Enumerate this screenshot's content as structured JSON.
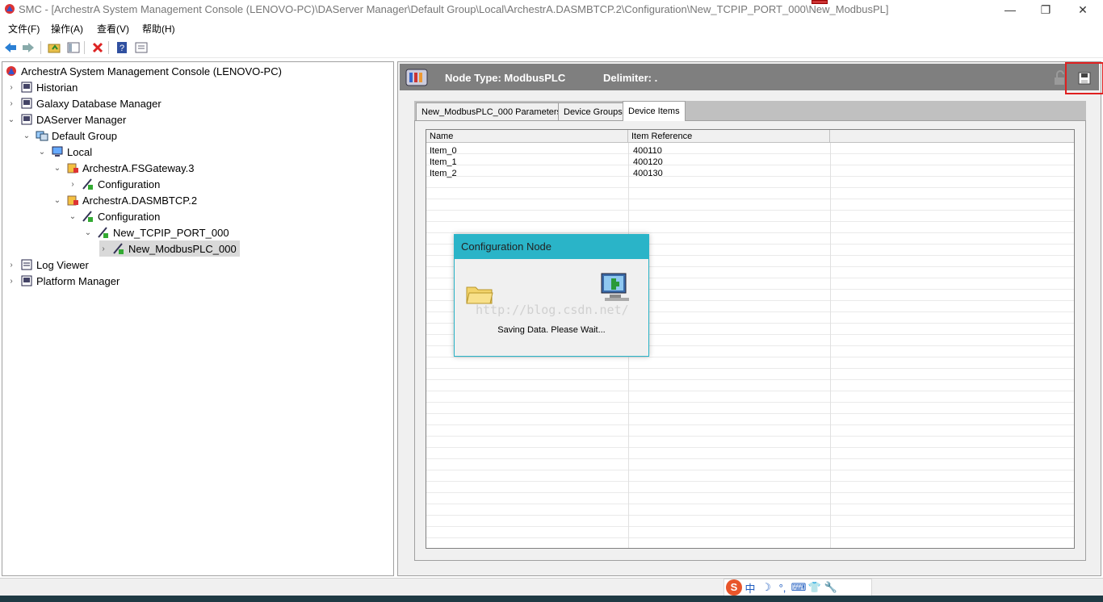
{
  "window": {
    "title": "SMC - [ArchestrA System Management Console (LENOVO-PC)\\DAServer Manager\\Default Group\\Local\\ArchestrA.DASMBTCP.2\\Configuration\\New_TCPIP_PORT_000\\New_ModbusPL]",
    "min_glyph": "—",
    "max_glyph": "❐",
    "close_glyph": "✕"
  },
  "menu": [
    "文件(F)",
    "操作(A)",
    "查看(V)",
    "帮助(H)"
  ],
  "tree": {
    "root": "ArchestrA System Management Console (LENOVO-PC)",
    "items": [
      {
        "label": "Historian",
        "exp": "›"
      },
      {
        "label": "Galaxy Database Manager",
        "exp": "›"
      },
      {
        "label": "DAServer Manager",
        "exp": "⌄"
      },
      {
        "label": "Default Group",
        "exp": "⌄"
      },
      {
        "label": "Local",
        "exp": "⌄"
      },
      {
        "label": "ArchestrA.FSGateway.3",
        "exp": "⌄"
      },
      {
        "label": "Configuration",
        "exp": "›"
      },
      {
        "label": "ArchestrA.DASMBTCP.2",
        "exp": "⌄"
      },
      {
        "label": "Configuration",
        "exp": "⌄"
      },
      {
        "label": "New_TCPIP_PORT_000",
        "exp": "⌄"
      },
      {
        "label": "New_ModbusPLC_000",
        "exp": "›"
      },
      {
        "label": "Log Viewer",
        "exp": "›"
      },
      {
        "label": "Platform Manager",
        "exp": "›"
      }
    ]
  },
  "header": {
    "node_type": "Node Type: ModbusPLC",
    "delimiter": "Delimiter:  ."
  },
  "tabs": [
    "New_ModbusPLC_000 Parameters",
    "Device Groups",
    "Device Items"
  ],
  "grid": {
    "columns": [
      "Name",
      "Item Reference"
    ],
    "rows": [
      {
        "name": "Item_0",
        "ref": "400110"
      },
      {
        "name": "Item_1",
        "ref": "400120"
      },
      {
        "name": "Item_2",
        "ref": "400130"
      }
    ]
  },
  "dialog": {
    "title": "Configuration Node",
    "watermark": "http://blog.csdn.net/",
    "message": "Saving Data. Please Wait..."
  },
  "ime": [
    "S",
    "中",
    "☽",
    "°,",
    "⌨",
    "👕",
    "🔧"
  ],
  "colors": {
    "header_bg": "#7f7f7f",
    "dialog_accent": "#2ab4c8",
    "highlight_red": "#e02020"
  }
}
